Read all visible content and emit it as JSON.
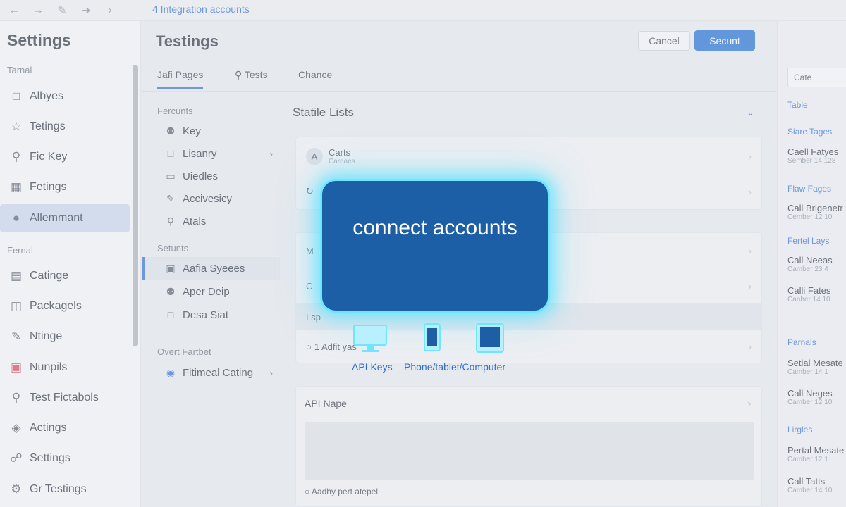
{
  "topbar": {
    "breadcrumb": "4 Integration accounts",
    "nav_icons": [
      "back-icon",
      "forward-icon",
      "edit-icon",
      "share-icon",
      "chevron-right-icon"
    ]
  },
  "sidebar": {
    "title": "Settings",
    "group1": "Tarnal",
    "group2": "Fernal",
    "items": [
      {
        "label": "Albyes",
        "icon": "chat-bubble-icon"
      },
      {
        "label": "Tetings",
        "icon": "star-icon"
      },
      {
        "label": "Fic Key",
        "icon": "key-icon"
      },
      {
        "label": "Fetings",
        "icon": "image-icon"
      },
      {
        "label": "Allemmant",
        "icon": "user-icon"
      },
      {
        "label": "Catinge",
        "icon": "bar-chart-icon"
      },
      {
        "label": "Packagels",
        "icon": "package-icon"
      },
      {
        "label": "Ntinge",
        "icon": "pen-icon"
      },
      {
        "label": "Nunpils",
        "icon": "camera-icon"
      },
      {
        "label": "Test Fictabols",
        "icon": "pin-icon"
      },
      {
        "label": "Actings",
        "icon": "globe-icon"
      },
      {
        "label": "Settings",
        "icon": "link-icon"
      },
      {
        "label": "Gr Testings",
        "icon": "gear-icon"
      }
    ]
  },
  "main": {
    "title": "Testings",
    "cancel_label": "Cancel",
    "primary_label": "Secunt",
    "tabs": [
      "Jafi Pages",
      "Tests",
      "Chance"
    ]
  },
  "subnav": {
    "group1": "Fercunts",
    "group2": "Setunts",
    "group3": "Overt Fartbet",
    "items1": [
      {
        "label": "Key",
        "icon": "person-icon"
      },
      {
        "label": "Lisanry",
        "icon": "document-icon"
      },
      {
        "label": "Uiedles",
        "icon": "monitor-icon"
      },
      {
        "label": "Accivesicy",
        "icon": "pencil-icon"
      },
      {
        "label": "Atals",
        "icon": "search-icon"
      }
    ],
    "items2": [
      {
        "label": "Aafia Syeees",
        "icon": "lock-icon"
      },
      {
        "label": "Aper Deip",
        "icon": "person-icon"
      },
      {
        "label": "Desa Siat",
        "icon": "message-icon"
      }
    ],
    "items3": [
      {
        "label": "Fitimeal Cating",
        "icon": "globe-icon"
      }
    ]
  },
  "content": {
    "section_title": "Statile Lists",
    "rows": [
      {
        "avatar": "A",
        "title": "Carts",
        "sub": "Cardaes"
      },
      {
        "avatar": "",
        "title": "",
        "sub": ""
      },
      {
        "avatar": "",
        "title": "M",
        "sub": ""
      },
      {
        "avatar": "",
        "title": "C",
        "sub": ""
      },
      {
        "avatar": "",
        "title": "Lsp",
        "sub": ""
      },
      {
        "avatar": "",
        "title": "1 Adfit yas",
        "sub": ""
      }
    ],
    "api_title": "API Nape",
    "api_radio_label": "Aadhy pert atepel"
  },
  "rpanel": {
    "input_value": "Cate",
    "groups": [
      {
        "head": "Table",
        "entries": []
      },
      {
        "head": "Siare Tages",
        "entries": [
          {
            "title": "Caell Fatyes",
            "sub": "Sember 14 128"
          }
        ]
      },
      {
        "head": "Flaw Fages",
        "entries": [
          {
            "title": "Call Brigenetr",
            "sub": "Cember 12 10"
          }
        ]
      },
      {
        "head": "Fertel Lays",
        "entries": [
          {
            "title": "Call Neeas",
            "sub": "Camber 23 4"
          },
          {
            "title": "Calli Fates",
            "sub": "Canber 14 10"
          }
        ]
      },
      {
        "head": "Parnals",
        "entries": [
          {
            "title": "Setial Mesate",
            "sub": "Camber 14 1"
          },
          {
            "title": "Call Neges",
            "sub": "Camber 12 10"
          }
        ]
      },
      {
        "head": "Lirgles",
        "entries": [
          {
            "title": "Pertal Mesate",
            "sub": "Camber 12 1"
          },
          {
            "title": "Call Tatts",
            "sub": "Camber 14 10"
          }
        ]
      }
    ]
  },
  "modal": {
    "title": "connect accounts",
    "devices": [
      {
        "icon": "monitor-icon",
        "label": "API Keys"
      },
      {
        "icon": "phone-icon",
        "label": "Phone/tablet/Computer"
      },
      {
        "icon": "tablet-icon",
        "label": ""
      }
    ],
    "glow_color": "#6fe6ff",
    "fill_color": "#1d5fa6"
  }
}
